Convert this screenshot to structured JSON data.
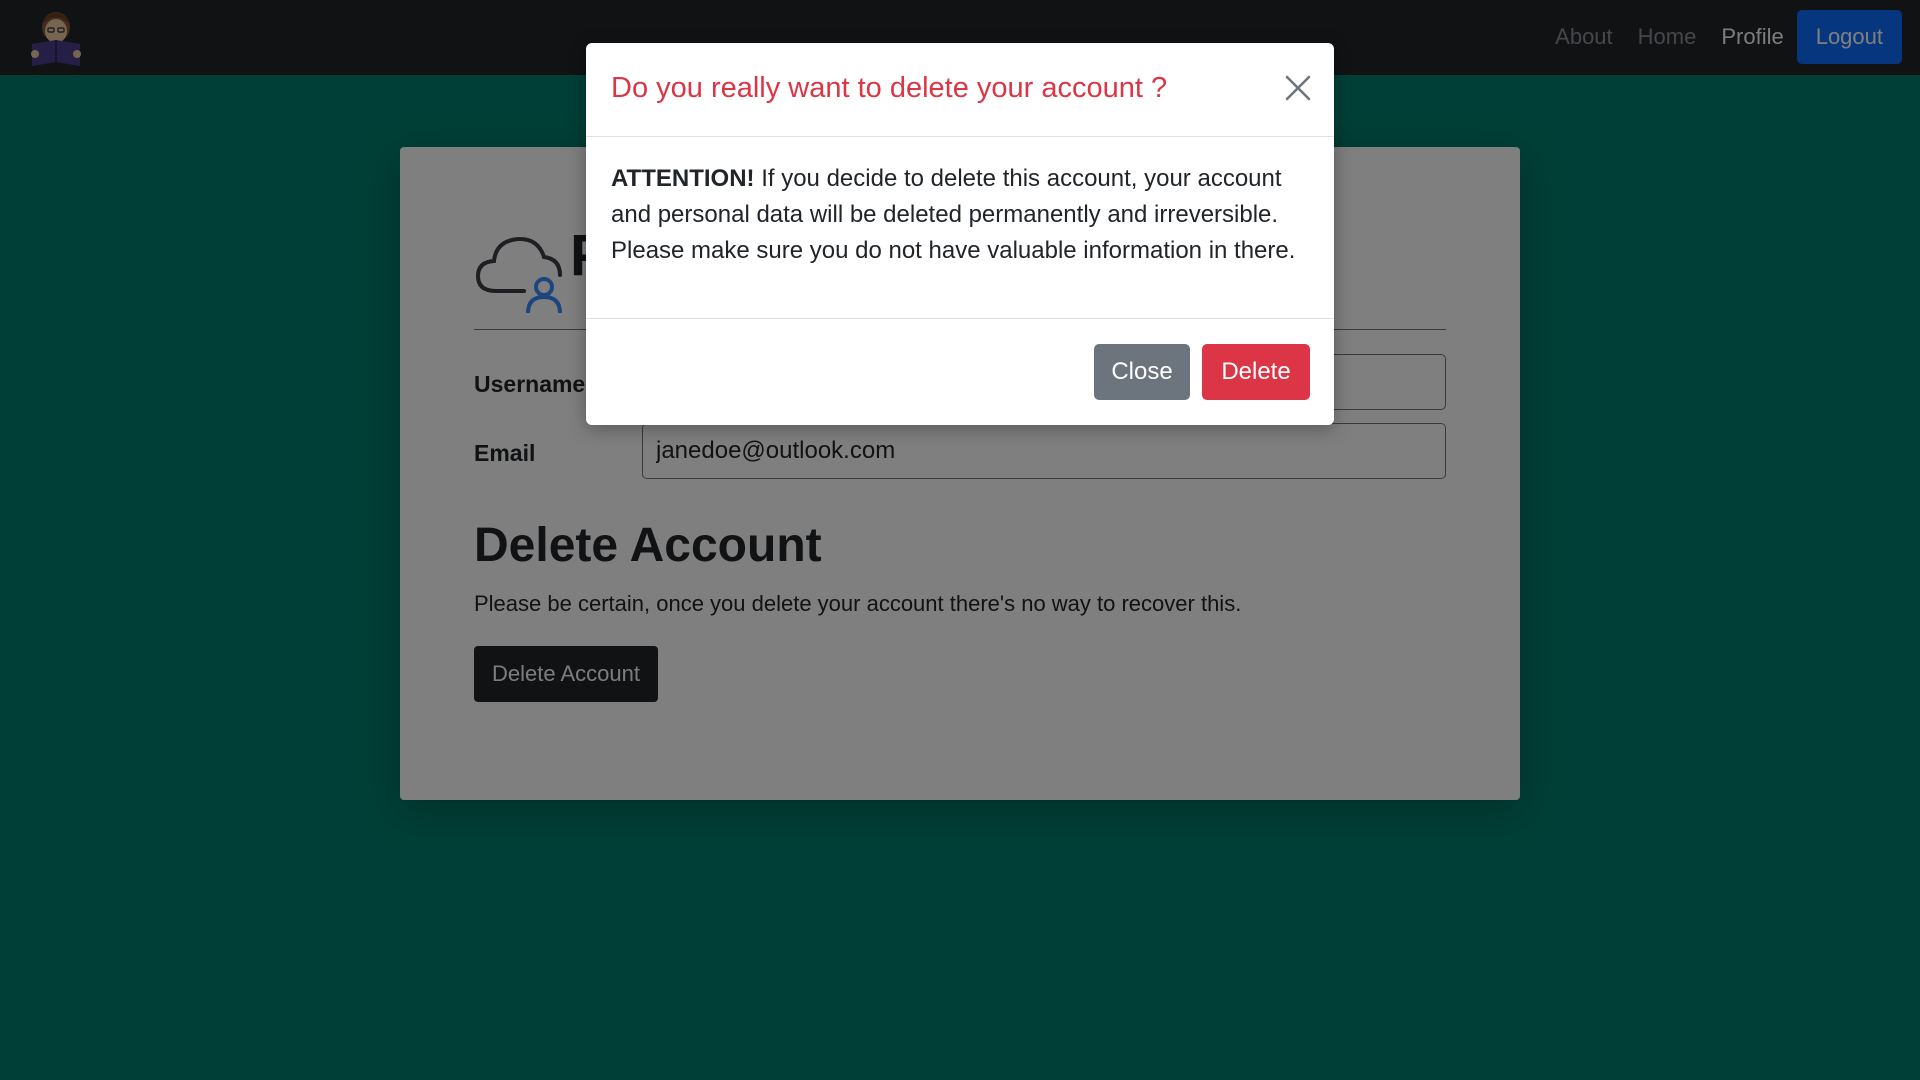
{
  "navbar": {
    "logo_icon": "reading-avatar-icon",
    "links": [
      {
        "label": "About"
      },
      {
        "label": "Home"
      },
      {
        "label": "Profile"
      }
    ],
    "logout_label": "Logout"
  },
  "profile_card": {
    "icon": "cloud-user-icon",
    "title_visible": "P",
    "fields": [
      {
        "label": "Username",
        "value": ""
      },
      {
        "label": "Email",
        "value": "janedoe@outlook.com"
      }
    ],
    "delete_section": {
      "heading": "Delete Account",
      "description": "Please be certain, once you delete your account there's no way to recover this.",
      "button_label": "Delete Account"
    }
  },
  "modal": {
    "title": "Do you really want to delete your account ?",
    "close_icon": "close-icon",
    "attention_label": "ATTENTION!",
    "body_text": " If you decide to delete this account, your account and personal data will be deleted permanently and irreversible. Please make sure you do not have valuable information in there.",
    "close_label": "Close",
    "delete_label": "Delete"
  },
  "colors": {
    "navbar_bg": "#212529",
    "page_bg": "#007f6e",
    "primary": "#0d6efd",
    "danger": "#dc3545",
    "secondary": "#6c757d"
  }
}
